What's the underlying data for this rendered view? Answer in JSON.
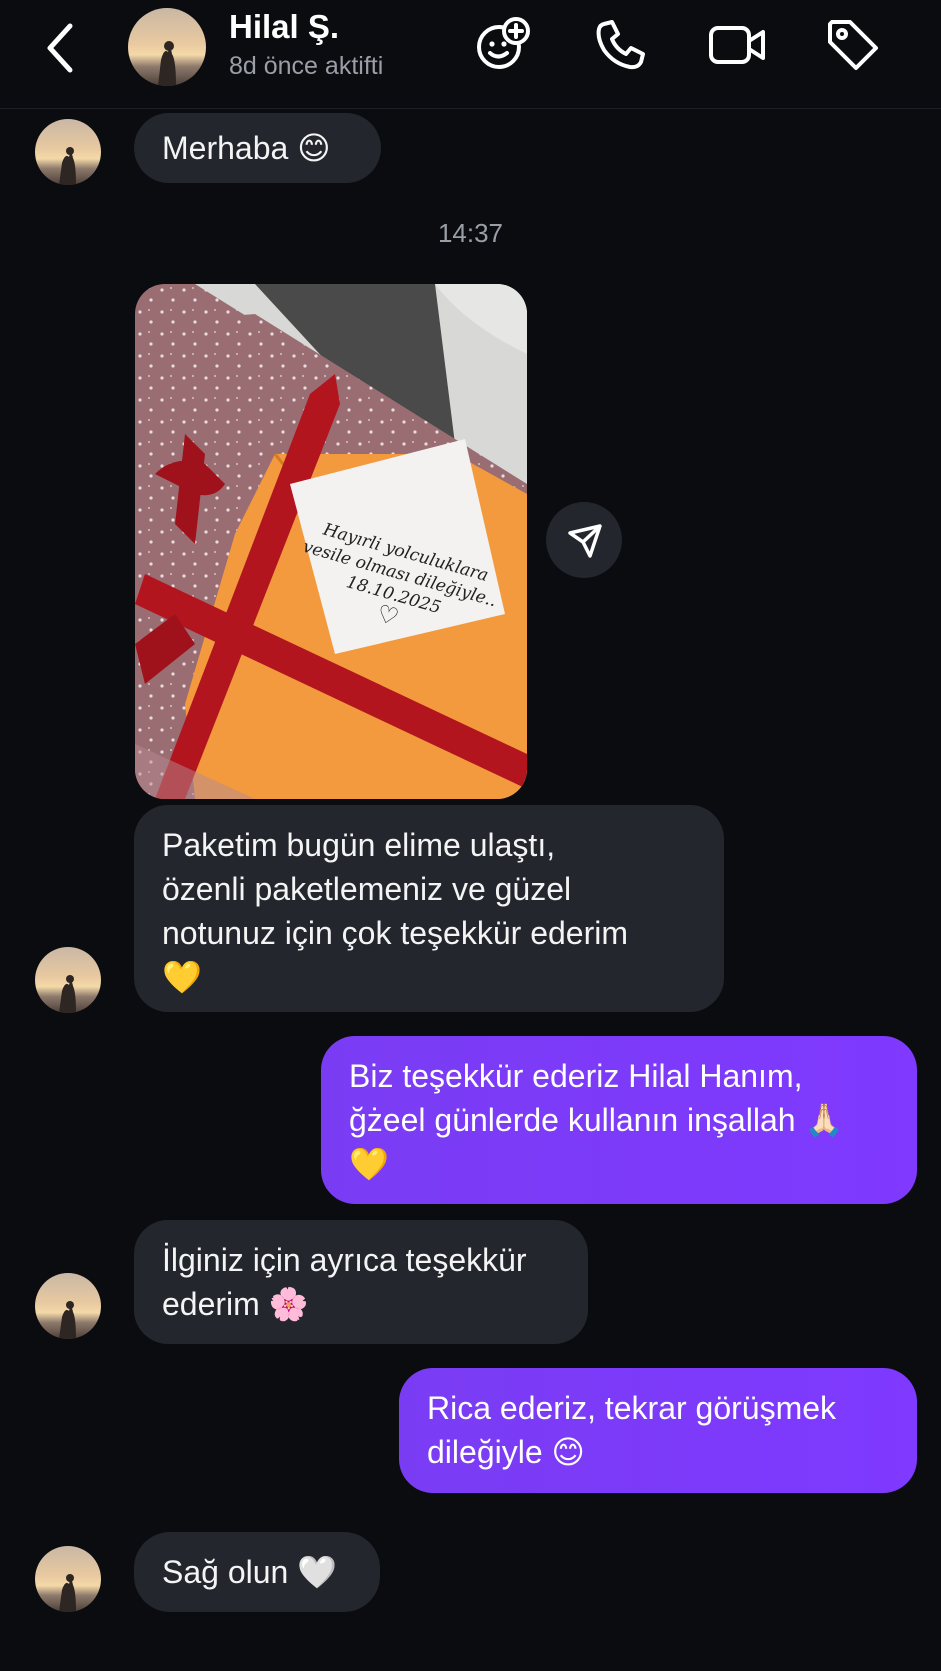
{
  "header": {
    "contact_name": "Hilal Ş.",
    "status": "8d önce aktifti",
    "icons": [
      "back-icon",
      "add-effect-icon",
      "phone-icon",
      "video-call-icon",
      "tag-icon"
    ]
  },
  "messages": {
    "m1": {
      "direction": "incoming",
      "text": "Merhaba 😊"
    },
    "timestamp": "14:37",
    "photo": {
      "note_line1": "Hayırli yolculuklara",
      "note_line2": "vesile olması dileğiyle..",
      "note_date": "18.10.2025",
      "note_heart": "♡"
    },
    "m2": {
      "direction": "incoming",
      "lines": [
        "Paketim bugün elime ulaştı,",
        "özenli paketlemeniz ve güzel",
        "notunuz için çok teşekkür ederim",
        "💛"
      ]
    },
    "m3": {
      "direction": "outgoing",
      "lines": [
        "Biz teşekkür ederiz Hilal Hanım,",
        "ğżeel günlerde kullanın inşallah 🙏🏻",
        "💛"
      ]
    },
    "m4": {
      "direction": "incoming",
      "lines": [
        "İlginiz için ayrıca teşekkür",
        "ederim 🌸"
      ]
    },
    "m5": {
      "direction": "outgoing",
      "lines": [
        "Rica ederiz, tekrar görüşmek",
        "dileğiyle 😊"
      ]
    },
    "m6": {
      "direction": "incoming",
      "text": "Sağ olun 🤍"
    }
  },
  "colors": {
    "background": "#0a0c10",
    "incoming_bubble": "#23262d",
    "outgoing_bubble": "#7b3cf8",
    "muted_text": "#9a9ea6"
  }
}
